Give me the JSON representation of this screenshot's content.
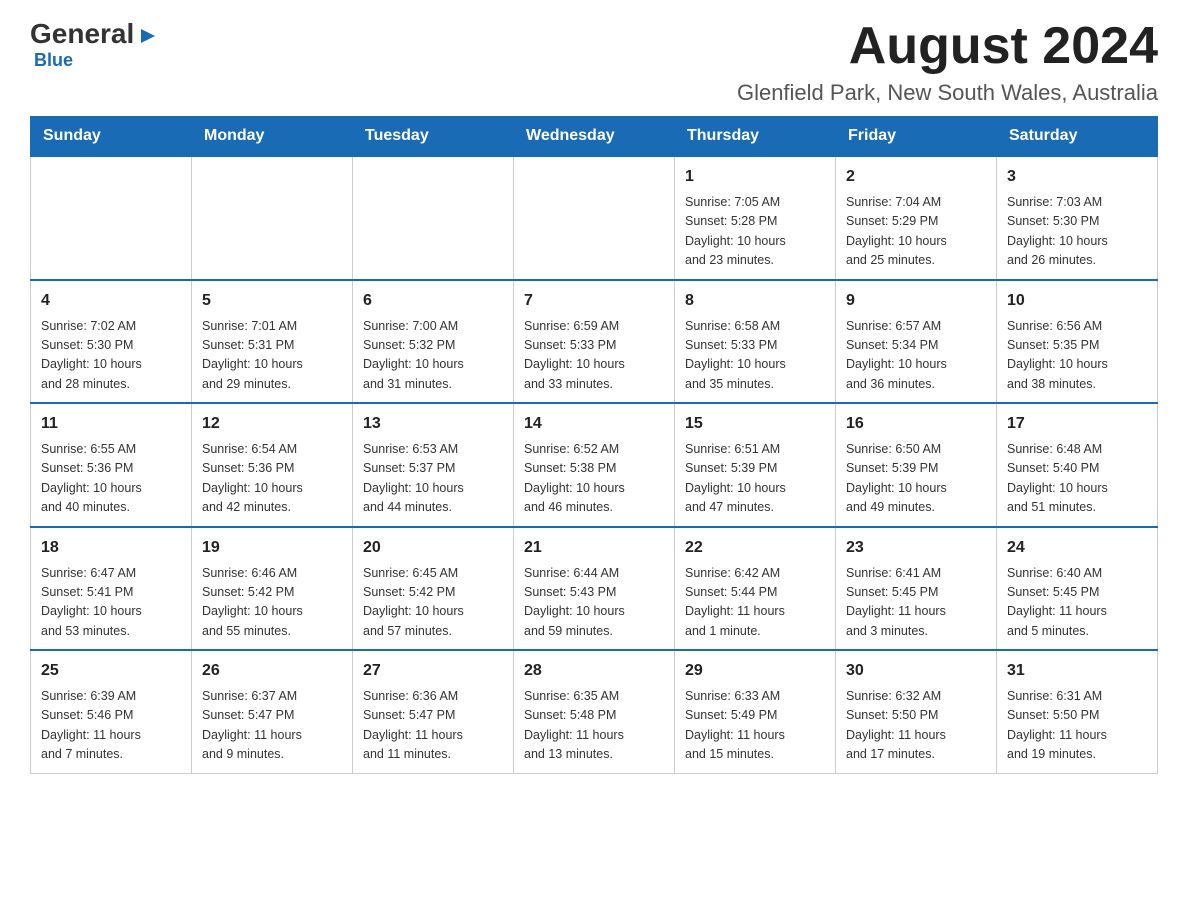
{
  "header": {
    "logo_main": "General",
    "logo_sub": "Blue",
    "month_title": "August 2024",
    "location": "Glenfield Park, New South Wales, Australia"
  },
  "days_of_week": [
    "Sunday",
    "Monday",
    "Tuesday",
    "Wednesday",
    "Thursday",
    "Friday",
    "Saturday"
  ],
  "weeks": [
    [
      {
        "day": "",
        "info": ""
      },
      {
        "day": "",
        "info": ""
      },
      {
        "day": "",
        "info": ""
      },
      {
        "day": "",
        "info": ""
      },
      {
        "day": "1",
        "info": "Sunrise: 7:05 AM\nSunset: 5:28 PM\nDaylight: 10 hours\nand 23 minutes."
      },
      {
        "day": "2",
        "info": "Sunrise: 7:04 AM\nSunset: 5:29 PM\nDaylight: 10 hours\nand 25 minutes."
      },
      {
        "day": "3",
        "info": "Sunrise: 7:03 AM\nSunset: 5:30 PM\nDaylight: 10 hours\nand 26 minutes."
      }
    ],
    [
      {
        "day": "4",
        "info": "Sunrise: 7:02 AM\nSunset: 5:30 PM\nDaylight: 10 hours\nand 28 minutes."
      },
      {
        "day": "5",
        "info": "Sunrise: 7:01 AM\nSunset: 5:31 PM\nDaylight: 10 hours\nand 29 minutes."
      },
      {
        "day": "6",
        "info": "Sunrise: 7:00 AM\nSunset: 5:32 PM\nDaylight: 10 hours\nand 31 minutes."
      },
      {
        "day": "7",
        "info": "Sunrise: 6:59 AM\nSunset: 5:33 PM\nDaylight: 10 hours\nand 33 minutes."
      },
      {
        "day": "8",
        "info": "Sunrise: 6:58 AM\nSunset: 5:33 PM\nDaylight: 10 hours\nand 35 minutes."
      },
      {
        "day": "9",
        "info": "Sunrise: 6:57 AM\nSunset: 5:34 PM\nDaylight: 10 hours\nand 36 minutes."
      },
      {
        "day": "10",
        "info": "Sunrise: 6:56 AM\nSunset: 5:35 PM\nDaylight: 10 hours\nand 38 minutes."
      }
    ],
    [
      {
        "day": "11",
        "info": "Sunrise: 6:55 AM\nSunset: 5:36 PM\nDaylight: 10 hours\nand 40 minutes."
      },
      {
        "day": "12",
        "info": "Sunrise: 6:54 AM\nSunset: 5:36 PM\nDaylight: 10 hours\nand 42 minutes."
      },
      {
        "day": "13",
        "info": "Sunrise: 6:53 AM\nSunset: 5:37 PM\nDaylight: 10 hours\nand 44 minutes."
      },
      {
        "day": "14",
        "info": "Sunrise: 6:52 AM\nSunset: 5:38 PM\nDaylight: 10 hours\nand 46 minutes."
      },
      {
        "day": "15",
        "info": "Sunrise: 6:51 AM\nSunset: 5:39 PM\nDaylight: 10 hours\nand 47 minutes."
      },
      {
        "day": "16",
        "info": "Sunrise: 6:50 AM\nSunset: 5:39 PM\nDaylight: 10 hours\nand 49 minutes."
      },
      {
        "day": "17",
        "info": "Sunrise: 6:48 AM\nSunset: 5:40 PM\nDaylight: 10 hours\nand 51 minutes."
      }
    ],
    [
      {
        "day": "18",
        "info": "Sunrise: 6:47 AM\nSunset: 5:41 PM\nDaylight: 10 hours\nand 53 minutes."
      },
      {
        "day": "19",
        "info": "Sunrise: 6:46 AM\nSunset: 5:42 PM\nDaylight: 10 hours\nand 55 minutes."
      },
      {
        "day": "20",
        "info": "Sunrise: 6:45 AM\nSunset: 5:42 PM\nDaylight: 10 hours\nand 57 minutes."
      },
      {
        "day": "21",
        "info": "Sunrise: 6:44 AM\nSunset: 5:43 PM\nDaylight: 10 hours\nand 59 minutes."
      },
      {
        "day": "22",
        "info": "Sunrise: 6:42 AM\nSunset: 5:44 PM\nDaylight: 11 hours\nand 1 minute."
      },
      {
        "day": "23",
        "info": "Sunrise: 6:41 AM\nSunset: 5:45 PM\nDaylight: 11 hours\nand 3 minutes."
      },
      {
        "day": "24",
        "info": "Sunrise: 6:40 AM\nSunset: 5:45 PM\nDaylight: 11 hours\nand 5 minutes."
      }
    ],
    [
      {
        "day": "25",
        "info": "Sunrise: 6:39 AM\nSunset: 5:46 PM\nDaylight: 11 hours\nand 7 minutes."
      },
      {
        "day": "26",
        "info": "Sunrise: 6:37 AM\nSunset: 5:47 PM\nDaylight: 11 hours\nand 9 minutes."
      },
      {
        "day": "27",
        "info": "Sunrise: 6:36 AM\nSunset: 5:47 PM\nDaylight: 11 hours\nand 11 minutes."
      },
      {
        "day": "28",
        "info": "Sunrise: 6:35 AM\nSunset: 5:48 PM\nDaylight: 11 hours\nand 13 minutes."
      },
      {
        "day": "29",
        "info": "Sunrise: 6:33 AM\nSunset: 5:49 PM\nDaylight: 11 hours\nand 15 minutes."
      },
      {
        "day": "30",
        "info": "Sunrise: 6:32 AM\nSunset: 5:50 PM\nDaylight: 11 hours\nand 17 minutes."
      },
      {
        "day": "31",
        "info": "Sunrise: 6:31 AM\nSunset: 5:50 PM\nDaylight: 11 hours\nand 19 minutes."
      }
    ]
  ]
}
